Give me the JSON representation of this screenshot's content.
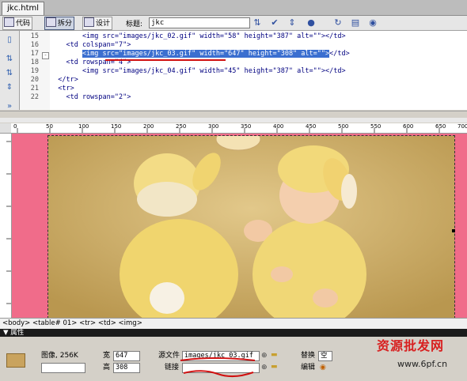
{
  "document": {
    "tab": "jkc.html"
  },
  "toolbar": {
    "code_label": "代码",
    "split_label": "拆分",
    "design_label": "设计",
    "title_label": "标题:",
    "title_value": "jkc"
  },
  "code_lines": [
    {
      "num": "15",
      "text": "        <img src=\"images/jkc_02.gif\" width=\"58\" height=\"387\" alt=\"\"></td>"
    },
    {
      "num": "16",
      "text": "    <td colspan=\"7\">"
    },
    {
      "num": "17",
      "pre": "        ",
      "highlight": "<img src=\"images/jkc_03.gif\" width=\"647\" height=\"308\" alt=\"\">",
      "post": "</td>"
    },
    {
      "num": "18",
      "text": "    <td rowspan=\"4\">"
    },
    {
      "num": "19",
      "text": "        <img src=\"images/jkc_04.gif\" width=\"45\" height=\"387\" alt=\"\"></td>"
    },
    {
      "num": "20",
      "text": "  </tr>"
    },
    {
      "num": "21",
      "text": "  <tr>"
    },
    {
      "num": "22",
      "text": "    <td rowspan=\"2\">"
    }
  ],
  "ruler": {
    "ticks": [
      "0",
      "50",
      "100",
      "150",
      "200",
      "250",
      "300",
      "350",
      "400",
      "450",
      "500",
      "550",
      "600",
      "650",
      "700"
    ]
  },
  "status_bar": {
    "tags": "<body> <table#  01> <tr> <td> <img>"
  },
  "properties": {
    "header": "▼ 属性",
    "image_info": "图像, 256K",
    "width_label": "宽",
    "width_value": "647",
    "height_label": "高",
    "height_value": "308",
    "src_label": "源文件",
    "src_value": "images/jkc_03.gif",
    "link_label": "链接",
    "alt_label": "替换",
    "alt_value": "空",
    "edit_label": "编辑"
  },
  "watermark": {
    "text": "资源批发网",
    "url": "www.6pf.cn"
  }
}
